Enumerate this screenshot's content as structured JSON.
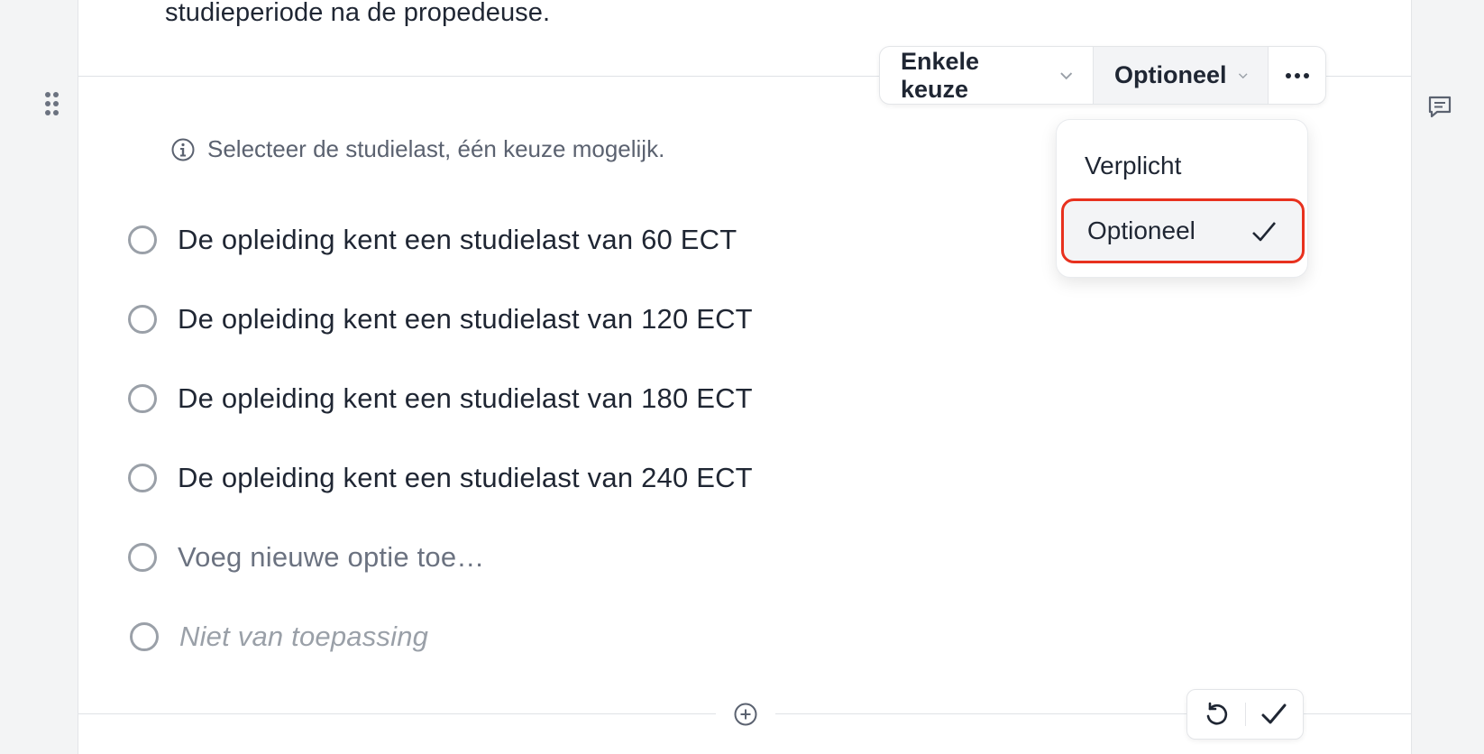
{
  "previous_question": {
    "text_tail": "studieperiode na de propedeuse."
  },
  "toolbar": {
    "question_type": "Enkele keuze",
    "requirement": "Optioneel",
    "more_icon": "ellipsis-icon"
  },
  "question": {
    "helper_text": "Selecteer de studielast, één keuze mogelijk.",
    "options": [
      "De opleiding kent een studielast van 60 ECT",
      "De opleiding kent een studielast van 120 ECT",
      "De opleiding kent een studielast van 180 ECT",
      "De opleiding kent een studielast van 240 ECT"
    ],
    "add_option_placeholder": "Voeg nieuwe optie toe…",
    "not_applicable": "Niet van toepassing"
  },
  "requirement_menu": {
    "items": [
      {
        "label": "Verplicht",
        "selected": false
      },
      {
        "label": "Optioneel",
        "selected": true
      }
    ],
    "highlight_color": "#e8311e"
  },
  "icons": {
    "drag": "drag-handle-icon",
    "comment": "comment-icon",
    "info": "info-icon",
    "add": "add-block-icon",
    "undo": "undo-icon",
    "confirm": "check-icon"
  }
}
